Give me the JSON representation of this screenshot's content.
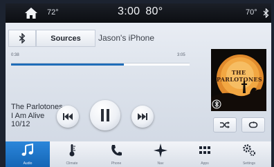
{
  "status_bar": {
    "outside_temp": "72°",
    "clock": "3:00",
    "cabin_temp": "80°",
    "right_temp": "70°",
    "icons": [
      "home-icon",
      "bluetooth-icon"
    ]
  },
  "source": {
    "icon": "bluetooth-icon",
    "sources_label": "Sources",
    "device_name": "Jason's iPhone"
  },
  "playback": {
    "elapsed": "0:38",
    "total": "3:05",
    "progress": 0.63,
    "artist": "The Parlotones",
    "track": "I Am Alive",
    "track_number": "10/12"
  },
  "album_art": {
    "title": "THE PARLOTONES",
    "badge_icon": "bluetooth-icon"
  },
  "controls": {
    "icons": [
      "previous-track-icon",
      "pause-icon",
      "next-track-icon",
      "shuffle-icon",
      "repeat-icon"
    ]
  },
  "bottom_nav": {
    "items": [
      {
        "label": "Audio",
        "icon": "music-note-icon"
      },
      {
        "label": "Climate",
        "icon": "thermometer-icon"
      },
      {
        "label": "Phone",
        "icon": "phone-icon"
      },
      {
        "label": "Nav",
        "icon": "compass-star-icon"
      },
      {
        "label": "Apps",
        "icon": "apps-grid-icon"
      },
      {
        "label": "Settings",
        "icon": "gears-icon"
      }
    ],
    "active_item": "Audio"
  },
  "colors": {
    "accent_blue": "#1f6db8",
    "active_tab": "#2b86da",
    "status_bar": "#12151b",
    "background": "#e4e9f1"
  }
}
